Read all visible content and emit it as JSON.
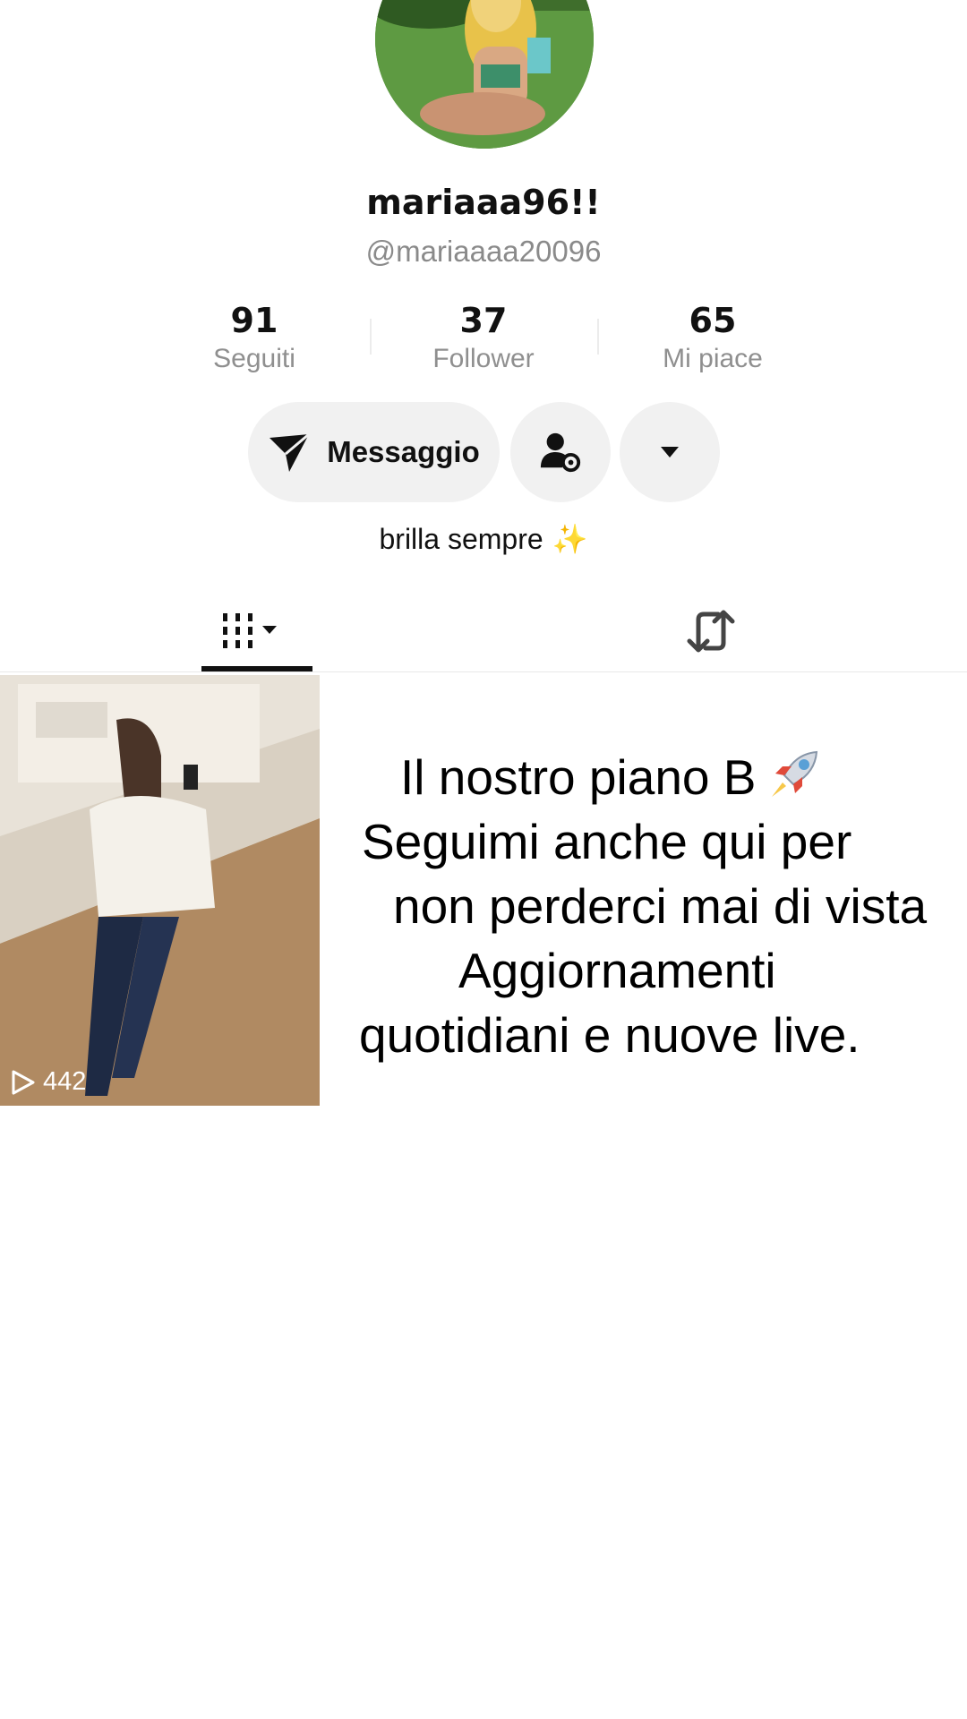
{
  "profile": {
    "display_name": "mariaaa96!!",
    "handle": "@mariaaaa20096",
    "bio_text": "brilla sempre",
    "bio_emoji": "✨"
  },
  "stats": [
    {
      "value": "91",
      "label": "Seguiti"
    },
    {
      "value": "37",
      "label": "Follower"
    },
    {
      "value": "65",
      "label": "Mi piace"
    }
  ],
  "actions": {
    "message_label": "Messaggio",
    "follow_icon": "person-gear-icon",
    "more_icon": "caret-down-icon"
  },
  "tabs": {
    "videos_icon": "grid-bars-icon",
    "reposts_icon": "repost-icon"
  },
  "videos": [
    {
      "views": "442"
    }
  ],
  "caption": {
    "line1": "Il nostro piano B",
    "line2": "Seguimi anche qui per",
    "line3": "non perderci mai di vista",
    "line4": "Aggiornamenti",
    "line5": "quotidiani e nuove live."
  },
  "colors": {
    "button_bg": "#f1f1f1",
    "muted_text": "#8a8a8a",
    "text": "#111111"
  }
}
